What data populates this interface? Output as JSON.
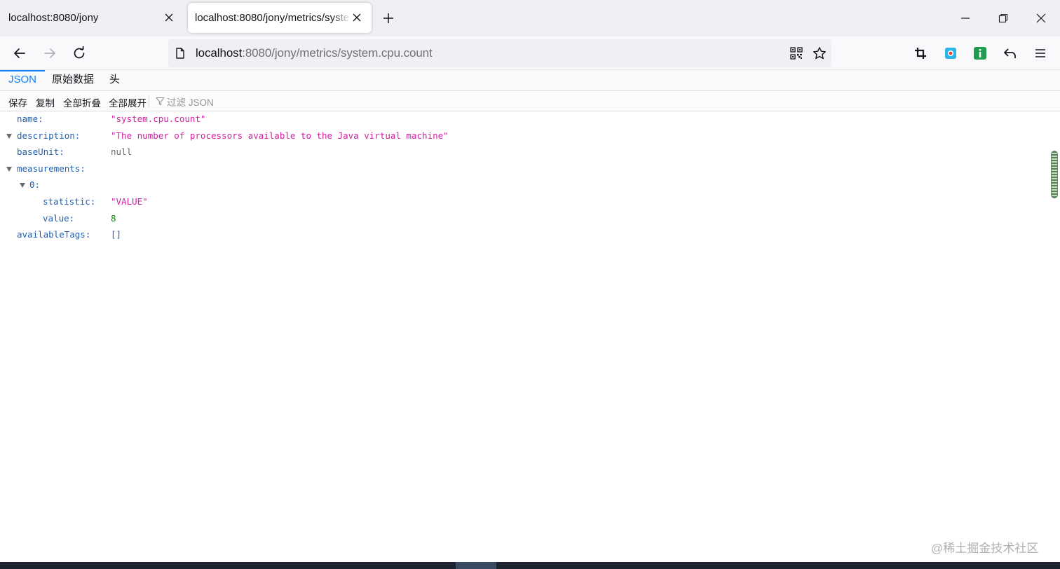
{
  "tabs": [
    {
      "title": "localhost:8080/jony",
      "active": false
    },
    {
      "title": "localhost:8080/jony/metrics/system.cpu.count",
      "active": true
    }
  ],
  "icons": {
    "tab_close": "close-icon",
    "new_tab": "plus-icon",
    "minimize": "minimize-icon",
    "restore": "restore-icon",
    "close_window": "close-icon",
    "back": "back-arrow-icon",
    "forward": "forward-arrow-icon",
    "reload": "reload-icon",
    "page": "page-icon",
    "qr": "qr-code-icon",
    "bookmark": "star-icon",
    "screenshot": "crop-icon",
    "ext_1": "extension-icon",
    "ext_2": "extension-icon",
    "undo": "undo-icon",
    "menu": "hamburger-menu-icon",
    "filter": "filter-icon"
  },
  "address": {
    "host": "localhost",
    "rest": ":8080/jony/metrics/system.cpu.count"
  },
  "viewer": {
    "tabs": [
      "JSON",
      "原始数据",
      "头"
    ],
    "selected_tab": "JSON",
    "toolbar": {
      "save": "保存",
      "copy": "复制",
      "collapse_all": "全部折叠",
      "expand_all": "全部展开",
      "filter_placeholder": "过滤 JSON"
    }
  },
  "json": {
    "rows": [
      {
        "key": "name:",
        "value": "\"system.cpu.count\"",
        "type": "string"
      },
      {
        "key": "description:",
        "value": "\"The number of processors available to the Java virtual machine\"",
        "type": "string"
      },
      {
        "key": "baseUnit:",
        "value": "null",
        "type": "null"
      },
      {
        "key": "measurements:",
        "value": "",
        "type": "object"
      },
      {
        "key": "0:",
        "value": "",
        "type": "object"
      },
      {
        "key": "statistic:",
        "value": "\"VALUE\"",
        "type": "string"
      },
      {
        "key": "value:",
        "value": "8",
        "type": "number"
      },
      {
        "key": "availableTags:",
        "value": "[]",
        "type": "array"
      }
    ]
  },
  "colors": {
    "accent": "#0a84ff",
    "json_key": "#1f5fb3",
    "json_string": "#d01fa0",
    "json_number": "#058b00",
    "json_null": "#6a6a6f"
  },
  "watermark": "@稀土掘金技术社区"
}
